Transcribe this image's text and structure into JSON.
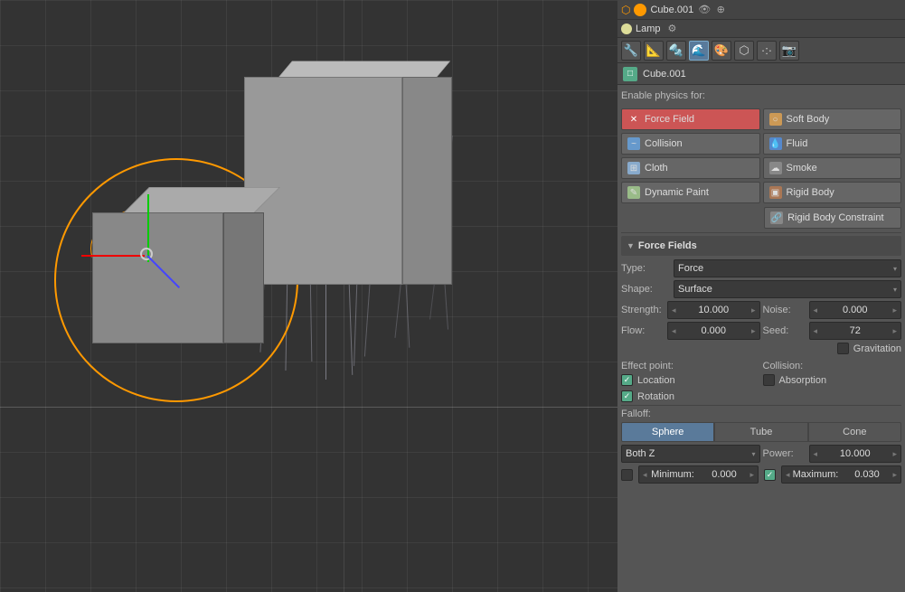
{
  "topbar": {
    "object_name": "Cube.001",
    "lamp_name": "Lamp"
  },
  "props_icons": [
    "🔧",
    "📐",
    "📦",
    "📷",
    "⚙",
    "🌊",
    "🎨",
    "🔵"
  ],
  "panel": {
    "enable_physics_label": "Enable physics for:",
    "physics_buttons": [
      {
        "id": "force-field",
        "label": "Force Field",
        "icon": "✕",
        "icon_class": "btn-icon-x",
        "active": true
      },
      {
        "id": "soft-body",
        "label": "Soft Body",
        "icon": "○",
        "icon_class": "btn-icon-softbody"
      },
      {
        "id": "collision",
        "label": "Collision",
        "icon": "~",
        "icon_class": "btn-icon-wave"
      },
      {
        "id": "fluid",
        "label": "Fluid",
        "icon": "💧",
        "icon_class": "btn-icon-fluid"
      },
      {
        "id": "cloth",
        "label": "Cloth",
        "icon": "⊞",
        "icon_class": "btn-icon-cloth"
      },
      {
        "id": "smoke",
        "label": "Smoke",
        "icon": "☁",
        "icon_class": "btn-icon-smoke"
      },
      {
        "id": "dynamic-paint",
        "label": "Dynamic Paint",
        "icon": "✎",
        "icon_class": "btn-icon-paint"
      },
      {
        "id": "rigid-body",
        "label": "Rigid Body",
        "icon": "▣",
        "icon_class": "btn-icon-rigid"
      }
    ],
    "rigid_body_constraint": "Rigid Body Constraint",
    "force_fields_section": "Force Fields",
    "type_label": "Type:",
    "type_value": "Force",
    "shape_label": "Shape:",
    "shape_value": "Surface",
    "strength_label": "Strength:",
    "strength_value": "10.000",
    "noise_label": "Noise:",
    "noise_value": "0.000",
    "flow_label": "Flow:",
    "flow_value": "0.000",
    "seed_label": "Seed:",
    "seed_value": "72",
    "gravitation_label": "Gravitation",
    "effect_point_label": "Effect point:",
    "collision_label": "Collision:",
    "location_label": "Location",
    "absorption_label": "Absorption",
    "rotation_label": "Rotation",
    "falloff_label": "Falloff:",
    "falloff_buttons": [
      "Sphere",
      "Tube",
      "Cone"
    ],
    "falloff_active": "Sphere",
    "both_z_label": "Both Z",
    "power_label": "Power:",
    "power_value": "10.000",
    "minimum_label": "Minimum:",
    "minimum_value": "0.000",
    "maximum_label": "Maximum:",
    "maximum_value": "0.030"
  }
}
